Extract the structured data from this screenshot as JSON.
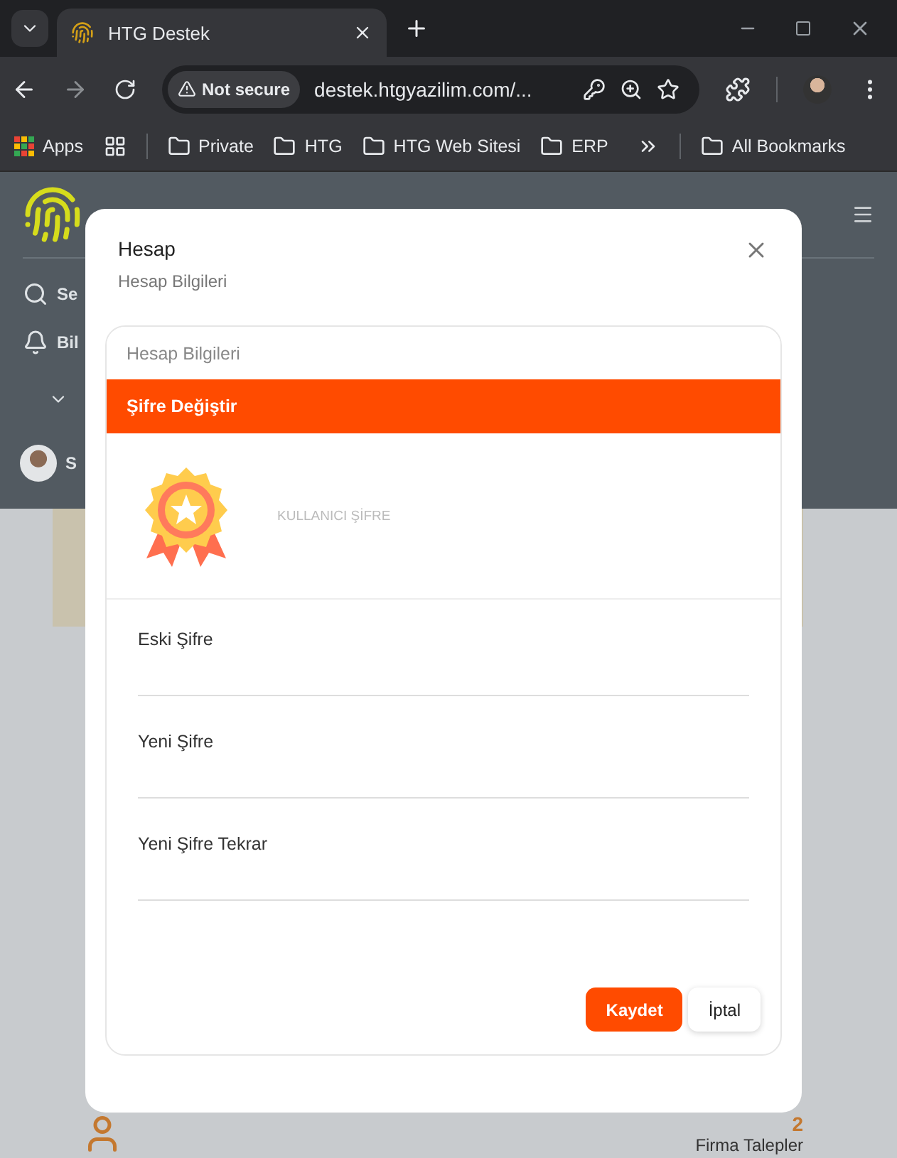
{
  "browser": {
    "tab_title": "HTG Destek",
    "security": "Not secure",
    "url": "destek.htgyazilim.com/...",
    "bookmarks": [
      {
        "label": "Apps",
        "kind": "apps"
      },
      {
        "label": "Private",
        "kind": "folder"
      },
      {
        "label": "HTG",
        "kind": "folder"
      },
      {
        "label": "HTG Web Sitesi",
        "kind": "folder"
      },
      {
        "label": "ERP",
        "kind": "folder"
      }
    ],
    "other_bookmarks": "All Bookmarks"
  },
  "sidebar": {
    "items": [
      {
        "label": "Se",
        "kind": "search"
      },
      {
        "label": "Bil",
        "kind": "bell"
      },
      {
        "kind": "chevron"
      },
      {
        "label": "S",
        "kind": "avatar"
      }
    ]
  },
  "stat": {
    "value": "2",
    "label": "Firma Talepler"
  },
  "modal": {
    "title": "Hesap",
    "subtitle": "Hesap Bilgileri",
    "tabs": [
      {
        "label": "Hesap Bilgileri",
        "selected": false
      },
      {
        "label": "Şifre Değiştir",
        "selected": true
      }
    ],
    "badge_caption": "KULLANICI ŞİFRE",
    "fields": [
      {
        "label": "Eski Şifre"
      },
      {
        "label": "Yeni Şifre"
      },
      {
        "label": "Yeni Şifre Tekrar"
      }
    ],
    "buttons": [
      {
        "label": "Kaydet",
        "kind": "primary"
      },
      {
        "label": "İptal",
        "kind": "secondary"
      }
    ]
  }
}
